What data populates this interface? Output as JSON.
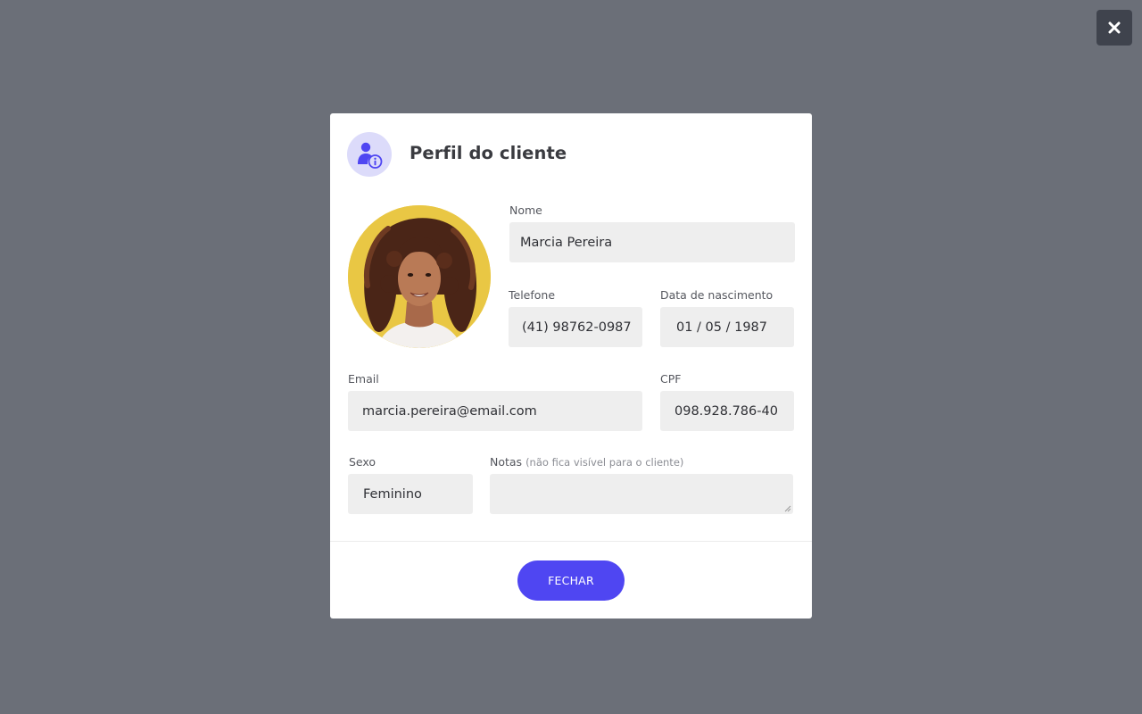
{
  "modal": {
    "title": "Perfil do cliente",
    "header_icon": "user-info-icon",
    "close_icon": "close-icon",
    "accent_color": "#4f46f2"
  },
  "avatar": {
    "background_color": "#e9c744"
  },
  "fields": {
    "nome": {
      "label": "Nome",
      "value": "Marcia Pereira"
    },
    "telefone": {
      "label": "Telefone",
      "value": "(41) 98762-0987"
    },
    "nascimento": {
      "label": "Data de nascimento",
      "value": "01 / 05 / 1987"
    },
    "email": {
      "label": "Email",
      "value": "marcia.pereira@email.com"
    },
    "cpf": {
      "label": "CPF",
      "value": "098.928.786-40"
    },
    "sexo": {
      "label": "Sexo",
      "value": "Feminino"
    },
    "notas": {
      "label": "Notas",
      "hint": "(não fica visível para o cliente)",
      "value": ""
    }
  },
  "footer": {
    "close_button": "FECHAR"
  }
}
